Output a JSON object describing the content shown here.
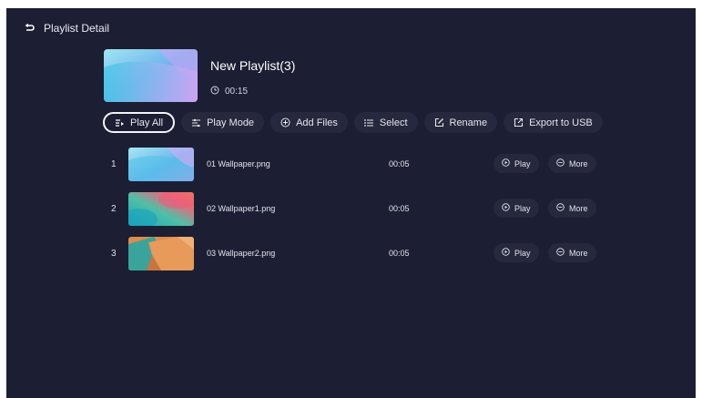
{
  "topbar": {
    "title": "Playlist Detail",
    "back_icon": "back-arrow-icon"
  },
  "playlist": {
    "name": "New Playlist(3)",
    "duration": "00:15"
  },
  "toolbar": {
    "play_all": "Play All",
    "play_mode": "Play Mode",
    "add_files": "Add Files",
    "select": "Select",
    "rename": "Rename",
    "export": "Export to USB"
  },
  "files": [
    {
      "index": "1",
      "name": "01 Wallpaper.png",
      "duration": "00:05",
      "play": "Play",
      "more": "More"
    },
    {
      "index": "2",
      "name": "02 Wallpaper1.png",
      "duration": "00:05",
      "play": "Play",
      "more": "More"
    },
    {
      "index": "3",
      "name": "03 Wallpaper2.png",
      "duration": "00:05",
      "play": "Play",
      "more": "More"
    }
  ],
  "colors": {
    "background": "#1c1e33",
    "button": "#26283d",
    "focus_border": "#f4f4f8"
  }
}
